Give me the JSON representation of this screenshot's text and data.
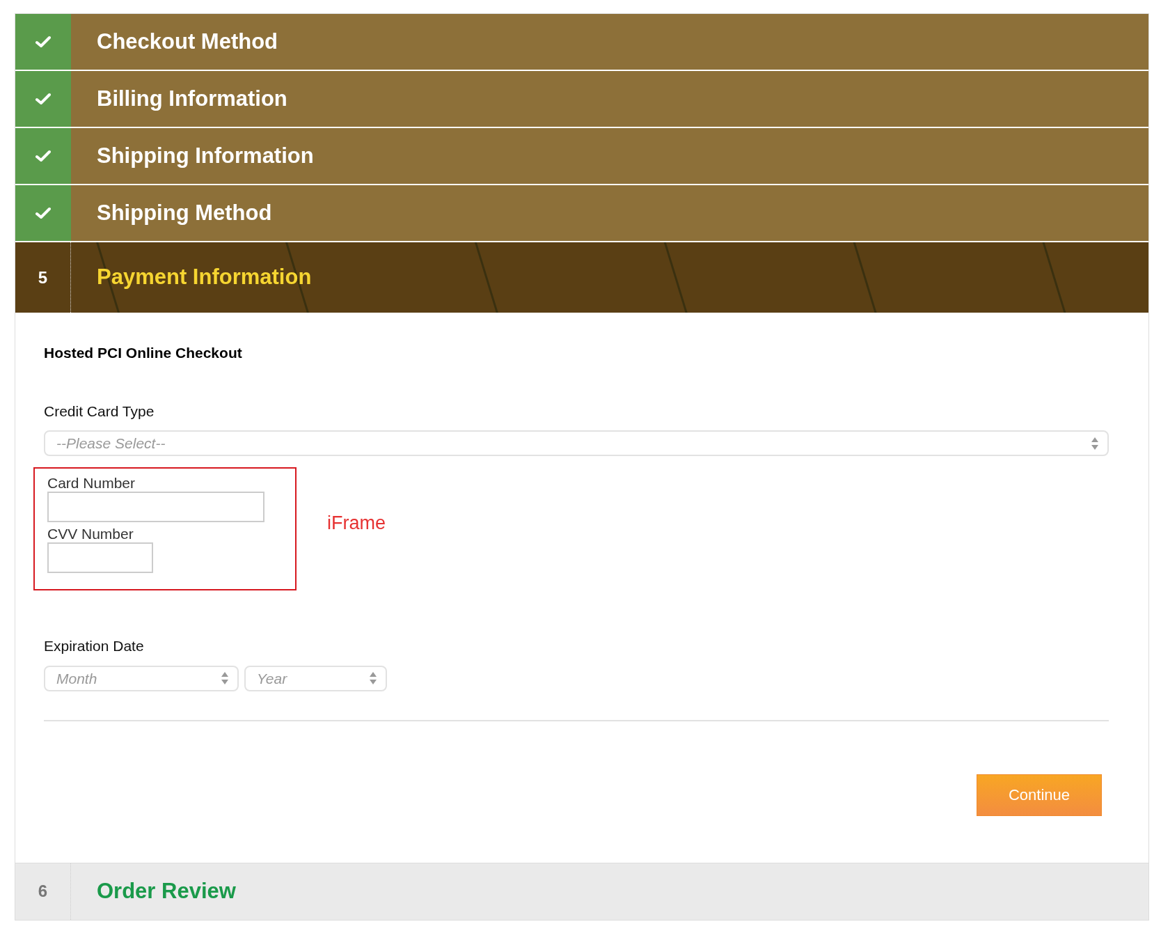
{
  "steps": [
    {
      "title": "Checkout Method",
      "completed": true,
      "selected": false
    },
    {
      "title": "Billing Information",
      "completed": true,
      "selected": false
    },
    {
      "title": "Shipping Information",
      "completed": true,
      "selected": false
    },
    {
      "title": "Shipping Method",
      "completed": true,
      "selected": false
    },
    {
      "number": "5",
      "title": "Payment Information",
      "completed": false,
      "selected": true
    },
    {
      "number": "6",
      "title": "Order Review",
      "completed": false,
      "selected": false
    }
  ],
  "payment": {
    "heading": "Hosted PCI Online Checkout",
    "card_type": {
      "label": "Credit Card Type",
      "placeholder": "--Please Select--"
    },
    "iframe": {
      "note": "iFrame",
      "fields": [
        {
          "label": "Card Number"
        },
        {
          "label": "CVV Number"
        }
      ]
    },
    "expiration": {
      "label": "Expiration Date",
      "selects": [
        {
          "placeholder": "Month"
        },
        {
          "placeholder": "Year"
        }
      ]
    },
    "button": "Continue"
  }
}
